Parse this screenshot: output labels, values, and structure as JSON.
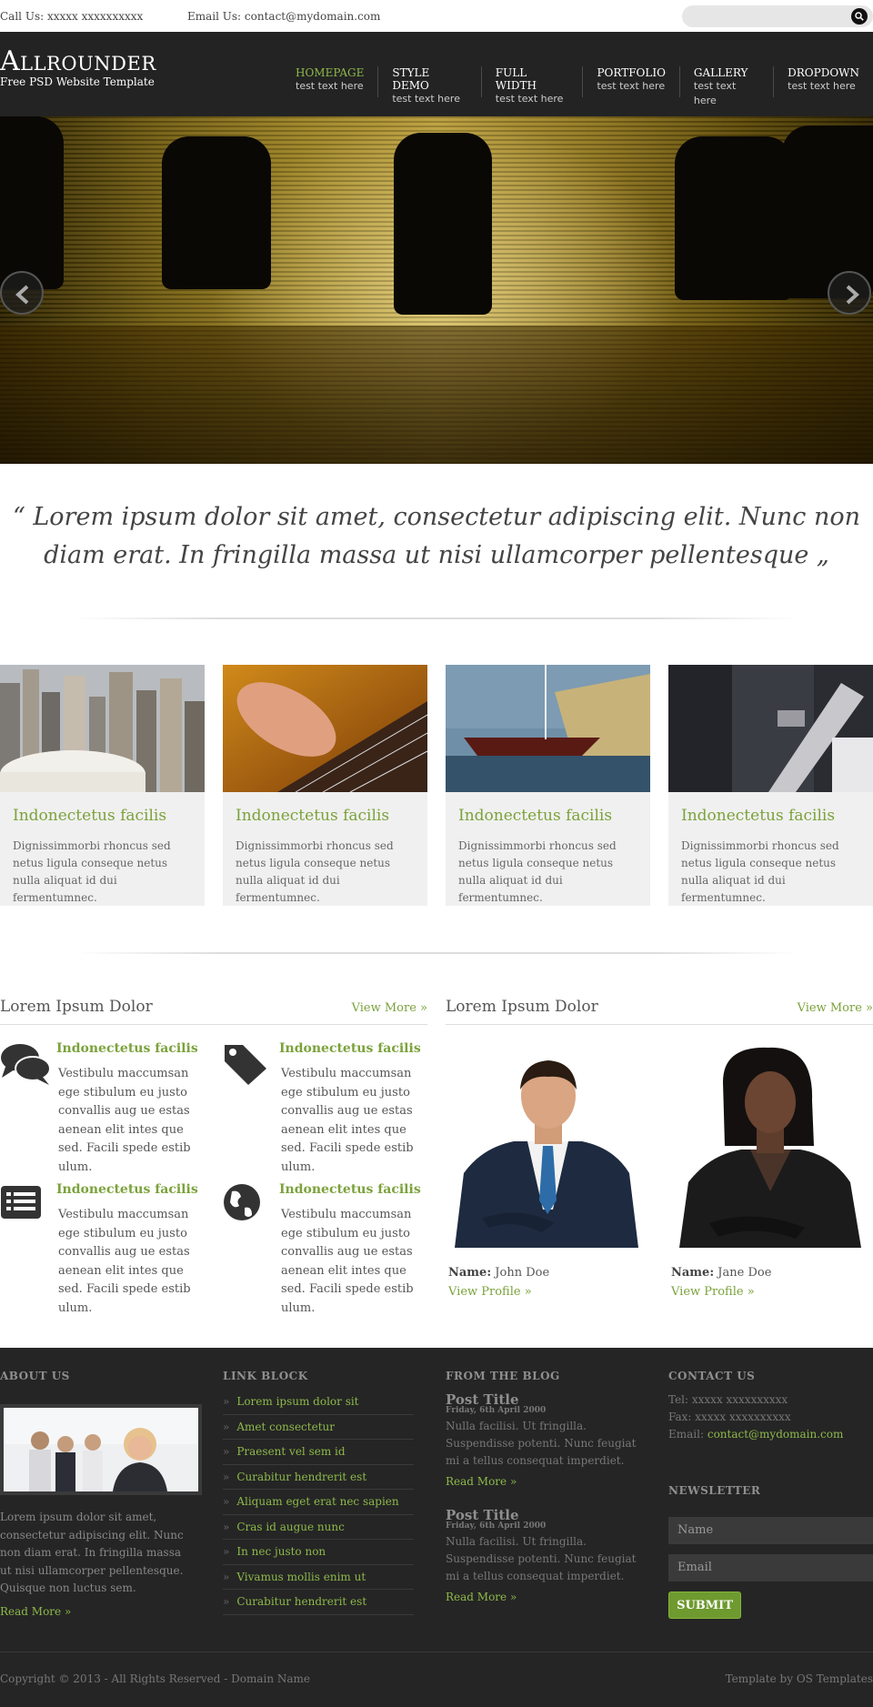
{
  "topbar": {
    "call": "Call Us: xxxxx xxxxxxxxxx",
    "email": "Email Us: contact@mydomain.com",
    "search_placeholder": ""
  },
  "header": {
    "logo": "Allrounder",
    "tagline": "Free PSD Website Template",
    "nav": [
      {
        "label": "Homepage",
        "sub": "test text here",
        "active": true
      },
      {
        "label": "Style Demo",
        "sub": "test text here"
      },
      {
        "label": "Full Width",
        "sub": "test text here"
      },
      {
        "label": "Portfolio",
        "sub": "test text here"
      },
      {
        "label": "Gallery",
        "sub": "test text here"
      },
      {
        "label": "Dropdown",
        "sub": "test text here"
      }
    ]
  },
  "quote": "“ Lorem ipsum dolor sit amet, consectetur adipiscing elit. Nunc non diam erat. In fringilla massa ut nisi ullamcorper pellentesque „",
  "features": [
    {
      "title": "Indonectetus facilis",
      "text": "Dignissimmorbi rhoncus sed netus ligula conseque netus nulla aliquat id dui fermentumnec."
    },
    {
      "title": "Indonectetus facilis",
      "text": "Dignissimmorbi rhoncus sed netus ligula conseque netus nulla aliquat id dui fermentumnec."
    },
    {
      "title": "Indonectetus facilis",
      "text": "Dignissimmorbi rhoncus sed netus ligula conseque netus nulla aliquat id dui fermentumnec."
    },
    {
      "title": "Indonectetus facilis",
      "text": "Dignissimmorbi rhoncus sed netus ligula conseque netus nulla aliquat id dui fermentumnec."
    }
  ],
  "services": {
    "heading": "Lorem Ipsum Dolor",
    "more": "View More »",
    "items": [
      {
        "icon": "comments-icon",
        "title": "Indonectetus facilis",
        "text": "Vestibulu maccumsan ege stibulum eu justo convallis aug ue estas aenean elit intes que sed. Facili spede estib ulum."
      },
      {
        "icon": "tags-icon",
        "title": "Indonectetus facilis",
        "text": "Vestibulu maccumsan ege stibulum eu justo convallis aug ue estas aenean elit intes que sed. Facili spede estib ulum."
      },
      {
        "icon": "list-icon",
        "title": "Indonectetus facilis",
        "text": "Vestibulu maccumsan ege stibulum eu justo convallis aug ue estas aenean elit intes que sed. Facili spede estib ulum."
      },
      {
        "icon": "globe-icon",
        "title": "Indonectetus facilis",
        "text": "Vestibulu maccumsan ege stibulum eu justo convallis aug ue estas aenean elit intes que sed. Facili spede estib ulum."
      }
    ]
  },
  "team": {
    "heading": "Lorem Ipsum Dolor",
    "more": "View More »",
    "members": [
      {
        "name_label": "Name:",
        "name": "John Doe",
        "link": "View Profile »"
      },
      {
        "name_label": "Name:",
        "name": "Jane Doe",
        "link": "View Profile »"
      }
    ]
  },
  "footer": {
    "about": {
      "heading": "About Us",
      "text": "Lorem ipsum dolor sit amet, consectetur adipiscing elit. Nunc non diam erat. In fringilla massa ut nisi ullamcorper pellentesque. Quisque non luctus sem.",
      "readmore": "Read More »"
    },
    "links": {
      "heading": "Link Block",
      "items": [
        "Lorem ipsum dolor sit",
        "Amet consectetur",
        "Praesent vel sem id",
        "Curabitur hendrerit est",
        "Aliquam eget erat nec sapien",
        "Cras id augue nunc",
        "In nec justo non",
        "Vivamus mollis enim ut",
        "Curabitur hendrerit est"
      ]
    },
    "blog": {
      "heading": "From The Blog",
      "posts": [
        {
          "title": "Post Title",
          "date": "Friday, 6th April 2000",
          "text": "Nulla facilisi. Ut fringilla. Suspendisse potenti. Nunc feugiat mi a tellus consequat imperdiet.",
          "readmore": "Read More »"
        },
        {
          "title": "Post Title",
          "date": "Friday, 6th April 2000",
          "text": "Nulla facilisi. Ut fringilla. Suspendisse potenti. Nunc feugiat mi a tellus consequat imperdiet.",
          "readmore": "Read More »"
        }
      ]
    },
    "contact": {
      "heading": "Contact Us",
      "tel": "Tel: xxxxx xxxxxxxxxx",
      "fax": "Fax: xxxxx xxxxxxxxxx",
      "email_label": "Email:",
      "email": "contact@mydomain.com"
    },
    "newsletter": {
      "heading": "Newsletter",
      "name_placeholder": "Name",
      "email_placeholder": "Email",
      "submit": "SUBMIT"
    }
  },
  "copyright": {
    "left": "Copyright © 2013 - All Rights Reserved - Domain Name",
    "right": "Template by OS Templates"
  },
  "colors": {
    "accent_green": "#7ba23b",
    "header_bg": "#232323",
    "footer_bg": "#252525"
  }
}
